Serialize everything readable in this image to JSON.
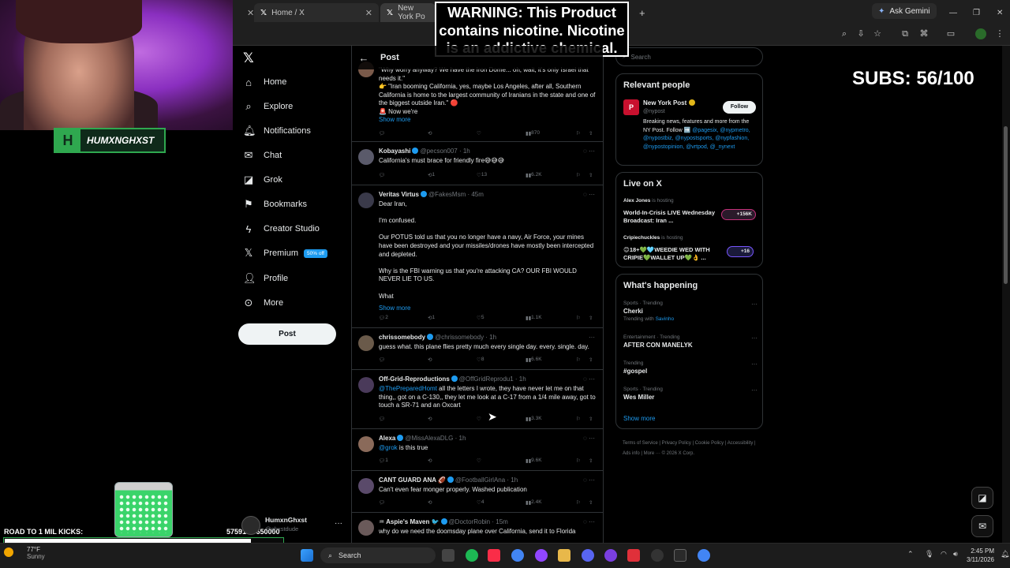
{
  "browser": {
    "tabs": [
      {
        "label": "Home / X"
      },
      {
        "label": "New York Po"
      }
    ],
    "ask_gemini": "Ask Gemini",
    "new_tab": "+"
  },
  "warning": {
    "text": "WARNING: This Product contains nicotine. Nicotine is an addictive chemical."
  },
  "stream": {
    "subs": "SUBS: 56/100",
    "logo_text": "HUMXNGHXST",
    "kicks_label": "ROAD TO 1 MIL KICKS:",
    "kicks_value": "575913 / 650000",
    "kicks_progress": 0.886
  },
  "nav": {
    "items": [
      {
        "label": "Home",
        "icon": "home-icon"
      },
      {
        "label": "Explore",
        "icon": "search-icon"
      },
      {
        "label": "Notifications",
        "icon": "bell-icon"
      },
      {
        "label": "Chat",
        "icon": "mail-icon"
      },
      {
        "label": "Grok",
        "icon": "grok-icon"
      },
      {
        "label": "Bookmarks",
        "icon": "bookmark-icon"
      },
      {
        "label": "Creator Studio",
        "icon": "bolt-icon"
      },
      {
        "label": "Premium",
        "icon": "x-logo-icon"
      },
      {
        "label": "Profile",
        "icon": "person-icon"
      },
      {
        "label": "More",
        "icon": "more-circle-icon"
      }
    ],
    "premium_badge": "50% off",
    "post_button": "Post",
    "account": {
      "name": "HumxnGhxst",
      "handle": "@ghxstdude"
    }
  },
  "feed": {
    "title": "Post",
    "tweets": [
      {
        "name": "",
        "handle": "",
        "time": "",
        "body": "\"Why worry anyway? We have the Iron Dome... oh, wait, it's only Israel that needs it.\"\n👉 \"Iran booming California, yes, maybe Los Angeles, after all, Southern California is home to the largest community of Iranians in the state and one of the biggest outside Iran.\" 🔴\n🚨 Now we're",
        "show_more": "Show more",
        "replies": "",
        "reposts": "",
        "likes": "",
        "views": "870"
      },
      {
        "name": "Kobayashi",
        "handle": "@pecson007",
        "time": "1h",
        "body": "California's must brace for friendly fire😅😅😅",
        "replies": "",
        "reposts": "1",
        "likes": "13",
        "views": "6.2K"
      },
      {
        "name": "Veritas Virtus",
        "handle": "@FakesMsm",
        "time": "45m",
        "body": "Dear Iran,\n\nI'm confused.\n\n Our POTUS told us that you no longer have a navy, Air Force, your mines have been destroyed and your missiles/drones have mostly been intercepted and depleted.\n\nWhy is the FBI warning us that you're attacking CA? OUR FBI WOULD NEVER LIE TO US.\n\nWhat",
        "show_more": "Show more",
        "replies": "2",
        "reposts": "1",
        "likes": "5",
        "views": "1.1K"
      },
      {
        "name": "chrissomebody",
        "handle": "@chrissomebody",
        "time": "1h",
        "body": "guess what. this plane flies pretty much every single day. every. single. day.",
        "replies": "",
        "reposts": "",
        "likes": "8",
        "views": "6.6K"
      },
      {
        "name": "Off-Grid-Reproductions",
        "handle": "@OffGridReprodu1",
        "time": "1h",
        "mention": "@ThePreparedHomt",
        "body": " all the letters I wrote, they have never let me on that thing,, got on a C-130,, they let me look at a C-17 from a 1/4 mile away, got to touch a SR-71 and an Oxcart",
        "replies": "",
        "reposts": "",
        "likes": "",
        "views": "3.3K"
      },
      {
        "name": "Alexa",
        "handle": "@MissAlexaDLG",
        "time": "1h",
        "mention": "@grok",
        "body": " is this true",
        "replies": "1",
        "reposts": "",
        "likes": "",
        "views": "9.6K"
      },
      {
        "name": "CANT GUARD ANA 🏈",
        "handle": "@FootballGirlAna",
        "time": "1h",
        "body": "Can't even fear monger properly. Washed publication",
        "replies": "",
        "reposts": "",
        "likes": "4",
        "views": "2.4K"
      },
      {
        "name": "♒ Aspie's Maven 🐦",
        "handle": "@DoctorRobin",
        "time": "15m",
        "body": "why do we need the doomsday plane over California, send it to Florida",
        "replies": "",
        "reposts": "",
        "likes": "",
        "views": ""
      }
    ]
  },
  "right": {
    "search_placeholder": "Search",
    "relevant": {
      "title": "Relevant people",
      "name": "New York Post",
      "handle": "@nypost",
      "follow": "Follow",
      "bio": "Breaking news, features and more from the NY Post. Follow ➡️ ",
      "bio_links": "@pagesix, @nypmetro, @nypostbiz, @nypostsports, @nypfashion, @nypostopinion, @vrtpod, @_nynext"
    },
    "live": {
      "title": "Live on X",
      "items": [
        {
          "host": "Alex Jones",
          "status": "is hosting",
          "title": "World-In-Crisis LIVE Wednesday Broadcast: Iran ...",
          "count": "+156K"
        },
        {
          "host": "Cripiechuckles",
          "status": "is hosting",
          "title": "😊18+💚🩵WEEDIE WED WITH CRIPIE💚WALLET UP💚👌 ...",
          "count": "+16"
        }
      ]
    },
    "happening": {
      "title": "What's happening",
      "trends": [
        {
          "cat": "Sports · Trending",
          "name": "Cherki",
          "sub": "Trending with ",
          "sub_link": "Savinho"
        },
        {
          "cat": "Entertainment · Trending",
          "name": "AFTER CON MANELYK",
          "sub": "",
          "sub_link": ""
        },
        {
          "cat": "Trending",
          "name": "#gospel",
          "sub": "",
          "sub_link": ""
        },
        {
          "cat": "Sports · Trending",
          "name": "Wes Miller",
          "sub": "",
          "sub_link": ""
        }
      ],
      "show_more": "Show more"
    },
    "footer": "Terms of Service  |  Privacy Policy  |  Cookie Policy  |  Accessibility  |  Ads info  |  More ···  © 2026 X Corp."
  },
  "taskbar": {
    "temp": "77°F",
    "condition": "Sunny",
    "search": "Search",
    "time": "2:45 PM",
    "date": "3/11/2026"
  }
}
